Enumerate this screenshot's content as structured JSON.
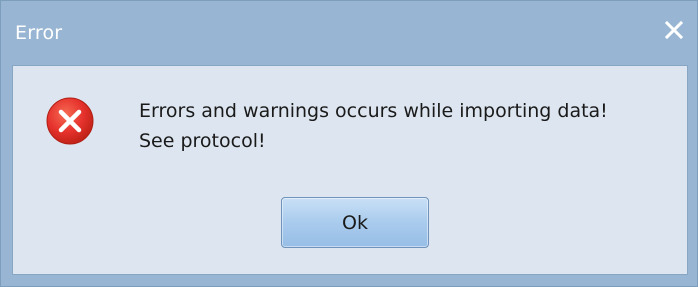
{
  "window": {
    "title": "Error"
  },
  "dialog": {
    "icon": "error-icon",
    "message_line_1": "Errors and warnings occurs while importing data!",
    "message_line_2": "See protocol!",
    "ok_label": "Ok"
  },
  "colors": {
    "frame": "#98b6d3",
    "content_background": "#dde6f0",
    "error_red": "#e6322d",
    "button": "#a9cbed"
  }
}
